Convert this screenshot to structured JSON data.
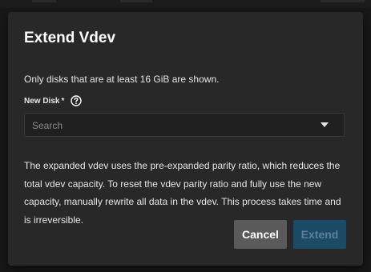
{
  "dialog": {
    "title": "Extend Vdev",
    "info": "Only disks that are at least 16 GiB are shown.",
    "new_disk": {
      "label": "New Disk",
      "required_marker": "*",
      "placeholder": "Search"
    },
    "description": "The expanded vdev uses the pre-expanded parity ratio, which reduces the total vdev capacity. To reset the vdev parity ratio and fully use the new capacity, manually rewrite all data in the vdev. This process takes time and is irreversible.",
    "actions": {
      "cancel_label": "Cancel",
      "extend_label": "Extend",
      "extend_disabled": true
    }
  },
  "icons": {
    "help": "help-circle-icon",
    "dropdown": "arrow-drop-down-icon"
  },
  "colors": {
    "dialog_bg": "#282828",
    "cancel_bg": "#5a5a5a",
    "extend_bg_disabled": "#1b4b66"
  }
}
